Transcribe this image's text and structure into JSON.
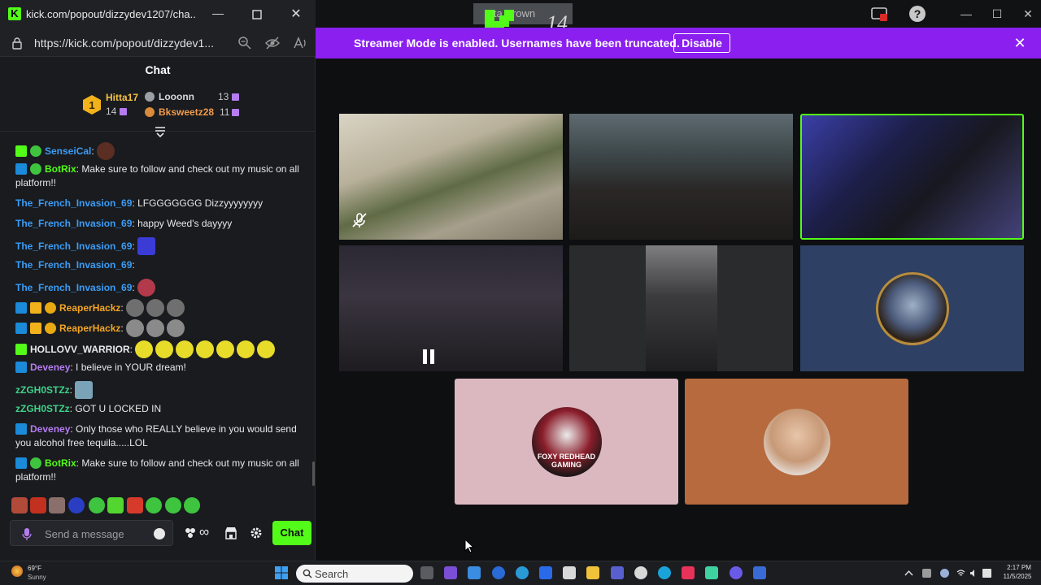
{
  "main_window": {
    "title_text": "utta Brown",
    "kick_overlay_number": "14",
    "streamer_banner": {
      "text": "Streamer Mode is enabled. Usernames have been truncated.",
      "disable_label": "Disable"
    },
    "tiles": [
      {
        "name": "cam-1",
        "state": "mic-muted"
      },
      {
        "name": "cam-2"
      },
      {
        "name": "cam-3",
        "state": "active-speaker"
      },
      {
        "name": "cam-4",
        "state": "paused"
      },
      {
        "name": "cam-5"
      },
      {
        "name": "avatar-6"
      },
      {
        "name": "avatar-7",
        "avatar_text": "FOXY REDHEAD GAMING"
      },
      {
        "name": "avatar-8"
      }
    ]
  },
  "chat_window": {
    "title": "kick.com/popout/dizzydev1207/cha...",
    "url": "https://kick.com/popout/dizzydev1...",
    "header_title": "Chat",
    "leaderboard": {
      "first": {
        "name": "Hitta17",
        "count": "14",
        "rank": "1"
      },
      "second": {
        "name": "Looonn",
        "count": "13"
      },
      "third": {
        "name": "Bksweetz28",
        "count": "11"
      }
    },
    "messages": [
      {
        "user": "SenseiCal",
        "text": "",
        "color": "#3b9cf5"
      },
      {
        "user": "BotRix",
        "text": "Make sure to follow and check out my music on all platform!!",
        "color": "#53fc18"
      },
      {
        "user": "The_French_Invasion_69",
        "text": "LFGGGGGGG Dizzyyyyyyyy",
        "color": "#3b9cf5"
      },
      {
        "user": "The_French_Invasion_69",
        "text": "happy Weed's dayyyy",
        "color": "#3b9cf5"
      },
      {
        "user": "The_French_Invasion_69",
        "text": "",
        "color": "#3b9cf5"
      },
      {
        "user": "The_French_Invasion_69",
        "text": "",
        "color": "#3b9cf5"
      },
      {
        "user": "The_French_Invasion_69",
        "text": "",
        "color": "#3b9cf5"
      },
      {
        "user": "ReaperHackz",
        "text": "",
        "color": "#f5a623"
      },
      {
        "user": "ReaperHackz",
        "text": "",
        "color": "#f5a623"
      },
      {
        "user": "HOLLOVV_WARRIOR",
        "text": "",
        "color": "#e8e8e8"
      },
      {
        "user": "Deveney",
        "text": "I believe in YOUR dream!",
        "color": "#b57cf0"
      },
      {
        "user": "zZGH0STZz",
        "text": "",
        "color": "#3fd28a"
      },
      {
        "user": "zZGH0STZz",
        "text": "GOT U LOCKED IN",
        "color": "#3fd28a"
      },
      {
        "user": "Deveney",
        "text": "Only those who REALLY believe in you would send you alcohol free tequila.....LOL",
        "color": "#b57cf0"
      },
      {
        "user": "BotRix",
        "text": "Make sure to follow and check out my music on all platform!!",
        "color": "#53fc18"
      }
    ],
    "input_placeholder": "Send a message",
    "send_label": "Chat",
    "accent": "#53fc18"
  },
  "taskbar": {
    "weather_temp": "69°F",
    "weather_condition": "Sunny",
    "search_label": "Search",
    "time": "2:17 PM",
    "date": "11/5/2025"
  }
}
